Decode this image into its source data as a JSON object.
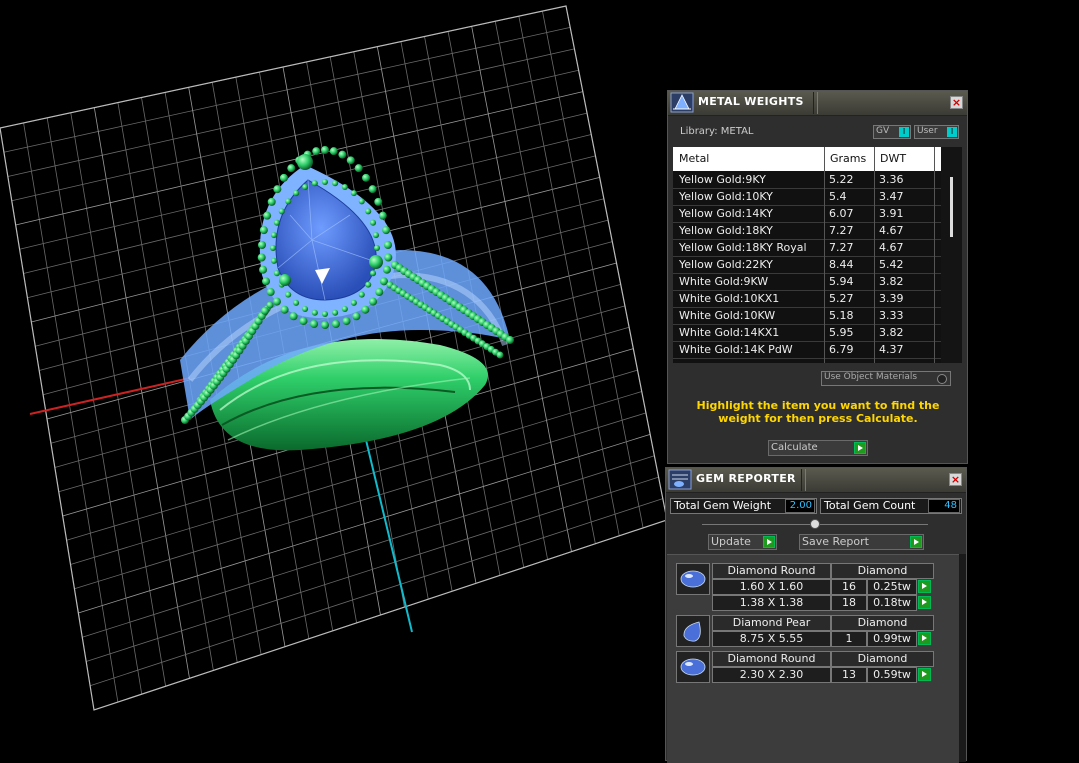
{
  "metal_weights": {
    "title": "METAL WEIGHTS",
    "library_label": "Library: METAL",
    "gv_label": "GV",
    "user_label": "User",
    "columns": [
      "Metal",
      "Grams",
      "DWT"
    ],
    "rows": [
      {
        "metal": "Yellow Gold:9KY",
        "grams": "5.22",
        "dwt": "3.36"
      },
      {
        "metal": "Yellow Gold:10KY",
        "grams": "5.4",
        "dwt": "3.47"
      },
      {
        "metal": "Yellow Gold:14KY",
        "grams": "6.07",
        "dwt": "3.91"
      },
      {
        "metal": "Yellow Gold:18KY",
        "grams": "7.27",
        "dwt": "4.67"
      },
      {
        "metal": "Yellow Gold:18KY Royal",
        "grams": "7.27",
        "dwt": "4.67"
      },
      {
        "metal": "Yellow Gold:22KY",
        "grams": "8.44",
        "dwt": "5.42"
      },
      {
        "metal": "White Gold:9KW",
        "grams": "5.94",
        "dwt": "3.82"
      },
      {
        "metal": "White Gold:10KX1",
        "grams": "5.27",
        "dwt": "3.39"
      },
      {
        "metal": "White Gold:10KW",
        "grams": "5.18",
        "dwt": "3.33"
      },
      {
        "metal": "White Gold:14KX1",
        "grams": "5.95",
        "dwt": "3.82"
      },
      {
        "metal": "White Gold:14K PdW",
        "grams": "6.79",
        "dwt": "4.37"
      }
    ],
    "use_object_materials": "Use Object Materials",
    "hint": "Highlight the item you want to find the weight for then press Calculate.",
    "calculate_label": "Calculate"
  },
  "gem_reporter": {
    "title": "GEM REPORTER",
    "total_weight_label": "Total Gem Weight",
    "total_weight_value": "2.00",
    "total_count_label": "Total Gem Count",
    "total_count_value": "48",
    "update_label": "Update",
    "save_report_label": "Save Report",
    "groups": [
      {
        "name": "Diamond Round",
        "material": "Diamond",
        "shape": "round",
        "rows": [
          {
            "size": "1.60 X 1.60",
            "count": "16",
            "weight": "0.25tw"
          },
          {
            "size": "1.38 X 1.38",
            "count": "18",
            "weight": "0.18tw"
          }
        ]
      },
      {
        "name": "Diamond Pear",
        "material": "Diamond",
        "shape": "pear",
        "rows": [
          {
            "size": "8.75 X 5.55",
            "count": "1",
            "weight": "0.99tw"
          }
        ]
      },
      {
        "name": "Diamond Round",
        "material": "Diamond",
        "shape": "round",
        "rows": [
          {
            "size": "2.30 X 2.30",
            "count": "13",
            "weight": "0.59tw"
          }
        ]
      }
    ]
  },
  "colors": {
    "hint_text": "#ffd700",
    "value_text": "#30c0ff",
    "ring_metal": "#2fcf6a",
    "gem_blue": "#3f6fd8",
    "axis_x": "#cc2222",
    "axis_y": "#11bbcc"
  }
}
